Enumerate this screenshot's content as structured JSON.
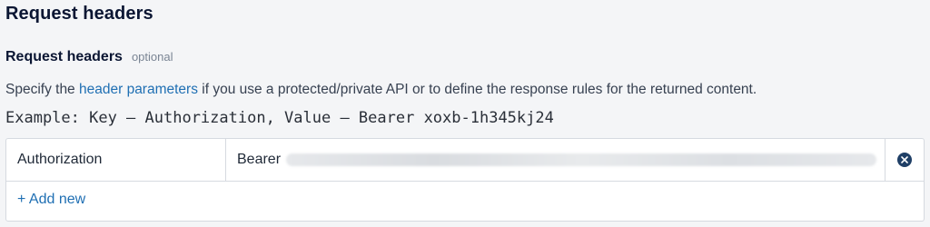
{
  "section": {
    "title": "Request headers"
  },
  "field": {
    "label": "Request headers",
    "optional": "optional",
    "description_before": "Specify the ",
    "description_link": "header parameters",
    "description_after": " if you use a protected/private API or to define the response rules for the returned content.",
    "example": "Example: Key – Authorization, Value – Bearer xoxb-1h345kj24"
  },
  "headers": [
    {
      "key": "Authorization",
      "value_prefix": "Bearer"
    }
  ],
  "actions": {
    "remove_icon": "close-circle-icon",
    "add_new": "+ Add new"
  },
  "colors": {
    "link": "#1f6fb3",
    "remove_icon_bg": "#1f3f66"
  }
}
